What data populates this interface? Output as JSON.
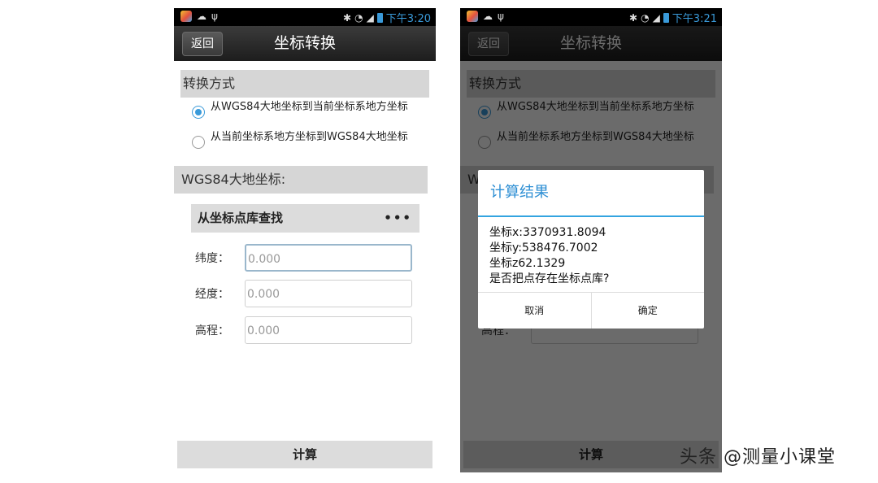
{
  "status_bar": {
    "left_time": "下午3:20",
    "right_time": "下午3:21"
  },
  "screen": {
    "back_label": "返回",
    "title": "坐标转换",
    "conversion_header": "转换方式",
    "options": [
      {
        "label": "从WGS84大地坐标到当前坐标系地方坐标",
        "checked": true
      },
      {
        "label": "从当前坐标系地方坐标到WGS84大地坐标",
        "checked": false
      }
    ],
    "wgs_header": "WGS84大地坐标:",
    "lookup_label": "从坐标点库查找",
    "lookup_dots": "•••",
    "fields": [
      {
        "label": "纬度：",
        "value": "0.000"
      },
      {
        "label": "经度：",
        "value": "0.000"
      },
      {
        "label": "高程：",
        "value": "0.000"
      }
    ],
    "calculate_label": "计算"
  },
  "dialog": {
    "title": "计算结果",
    "lines": [
      "坐标x:3370931.8094",
      "坐标y:538476.7002",
      "坐标z62.1329",
      "是否把点存在坐标点库?"
    ],
    "cancel_label": "取消",
    "confirm_label": "确定"
  },
  "watermark": "头条 @测量小课堂",
  "colors": {
    "accent": "#33a4e0",
    "title_bar": "#2a2a2a",
    "section_bg": "#d6d6d6"
  },
  "icons": [
    "app-icon",
    "android-icon",
    "usb-icon",
    "bluetooth-icon",
    "wifi-icon",
    "signal-icon",
    "battery-icon"
  ]
}
